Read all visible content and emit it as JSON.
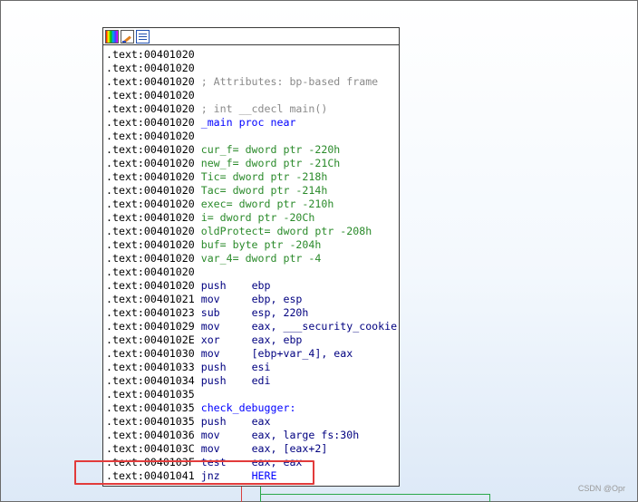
{
  "watermark": "CSDN @Opr",
  "colors": {
    "comment": "#8a8a8a",
    "label": "#0000ff",
    "variable": "#2a8a2a",
    "instruction": "#000080",
    "highlight_box": "#e23b3b",
    "edge_true": "#2ba84a",
    "edge_false": "#d94040"
  },
  "node_toolbar": {
    "icons": [
      "color-palette-icon",
      "edit-node-icon",
      "graph-view-icon"
    ]
  },
  "lines": [
    {
      "addr": ".text:00401020",
      "text": "",
      "kind": "blank"
    },
    {
      "addr": ".text:00401020",
      "text": "",
      "kind": "blank"
    },
    {
      "addr": ".text:00401020",
      "text": "; Attributes: bp-based frame",
      "kind": "comment"
    },
    {
      "addr": ".text:00401020",
      "text": "",
      "kind": "blank"
    },
    {
      "addr": ".text:00401020",
      "text": "; int __cdecl main()",
      "kind": "comment"
    },
    {
      "addr": ".text:00401020",
      "text": "_main proc near",
      "kind": "label"
    },
    {
      "addr": ".text:00401020",
      "text": "",
      "kind": "blank"
    },
    {
      "addr": ".text:00401020",
      "text": "cur_f= dword ptr -220h",
      "kind": "var"
    },
    {
      "addr": ".text:00401020",
      "text": "new_f= dword ptr -21Ch",
      "kind": "var"
    },
    {
      "addr": ".text:00401020",
      "text": "Tic= dword ptr -218h",
      "kind": "var"
    },
    {
      "addr": ".text:00401020",
      "text": "Tac= dword ptr -214h",
      "kind": "var"
    },
    {
      "addr": ".text:00401020",
      "text": "exec= dword ptr -210h",
      "kind": "var"
    },
    {
      "addr": ".text:00401020",
      "text": "i= dword ptr -20Ch",
      "kind": "var"
    },
    {
      "addr": ".text:00401020",
      "text": "oldProtect= dword ptr -208h",
      "kind": "var"
    },
    {
      "addr": ".text:00401020",
      "text": "buf= byte ptr -204h",
      "kind": "var"
    },
    {
      "addr": ".text:00401020",
      "text": "var_4= dword ptr -4",
      "kind": "var"
    },
    {
      "addr": ".text:00401020",
      "text": "",
      "kind": "blank"
    },
    {
      "addr": ".text:00401020",
      "mnem": "push",
      "ops": "ebp",
      "kind": "ins"
    },
    {
      "addr": ".text:00401021",
      "mnem": "mov",
      "ops": "ebp, esp",
      "kind": "ins"
    },
    {
      "addr": ".text:00401023",
      "mnem": "sub",
      "ops": "esp, 220h",
      "kind": "ins"
    },
    {
      "addr": ".text:00401029",
      "mnem": "mov",
      "ops": "eax, ___security_cookie",
      "kind": "ins"
    },
    {
      "addr": ".text:0040102E",
      "mnem": "xor",
      "ops": "eax, ebp",
      "kind": "ins"
    },
    {
      "addr": ".text:00401030",
      "mnem": "mov",
      "ops": "[ebp+var_4], eax",
      "kind": "ins"
    },
    {
      "addr": ".text:00401033",
      "mnem": "push",
      "ops": "esi",
      "kind": "ins"
    },
    {
      "addr": ".text:00401034",
      "mnem": "push",
      "ops": "edi",
      "kind": "ins"
    },
    {
      "addr": ".text:00401035",
      "text": "",
      "kind": "blank"
    },
    {
      "addr": ".text:00401035",
      "text": "check_debugger:",
      "kind": "label"
    },
    {
      "addr": ".text:00401035",
      "mnem": "push",
      "ops": "eax",
      "kind": "ins"
    },
    {
      "addr": ".text:00401036",
      "mnem": "mov",
      "ops": "eax, large fs:30h",
      "kind": "ins"
    },
    {
      "addr": ".text:0040103C",
      "mnem": "mov",
      "ops": "eax, [eax+2]",
      "kind": "ins"
    },
    {
      "addr": ".text:0040103F",
      "mnem": "test",
      "ops": "eax, eax",
      "kind": "ins"
    },
    {
      "addr": ".text:00401041",
      "mnem": "jnz",
      "ops": "HERE",
      "kind": "jump"
    }
  ]
}
